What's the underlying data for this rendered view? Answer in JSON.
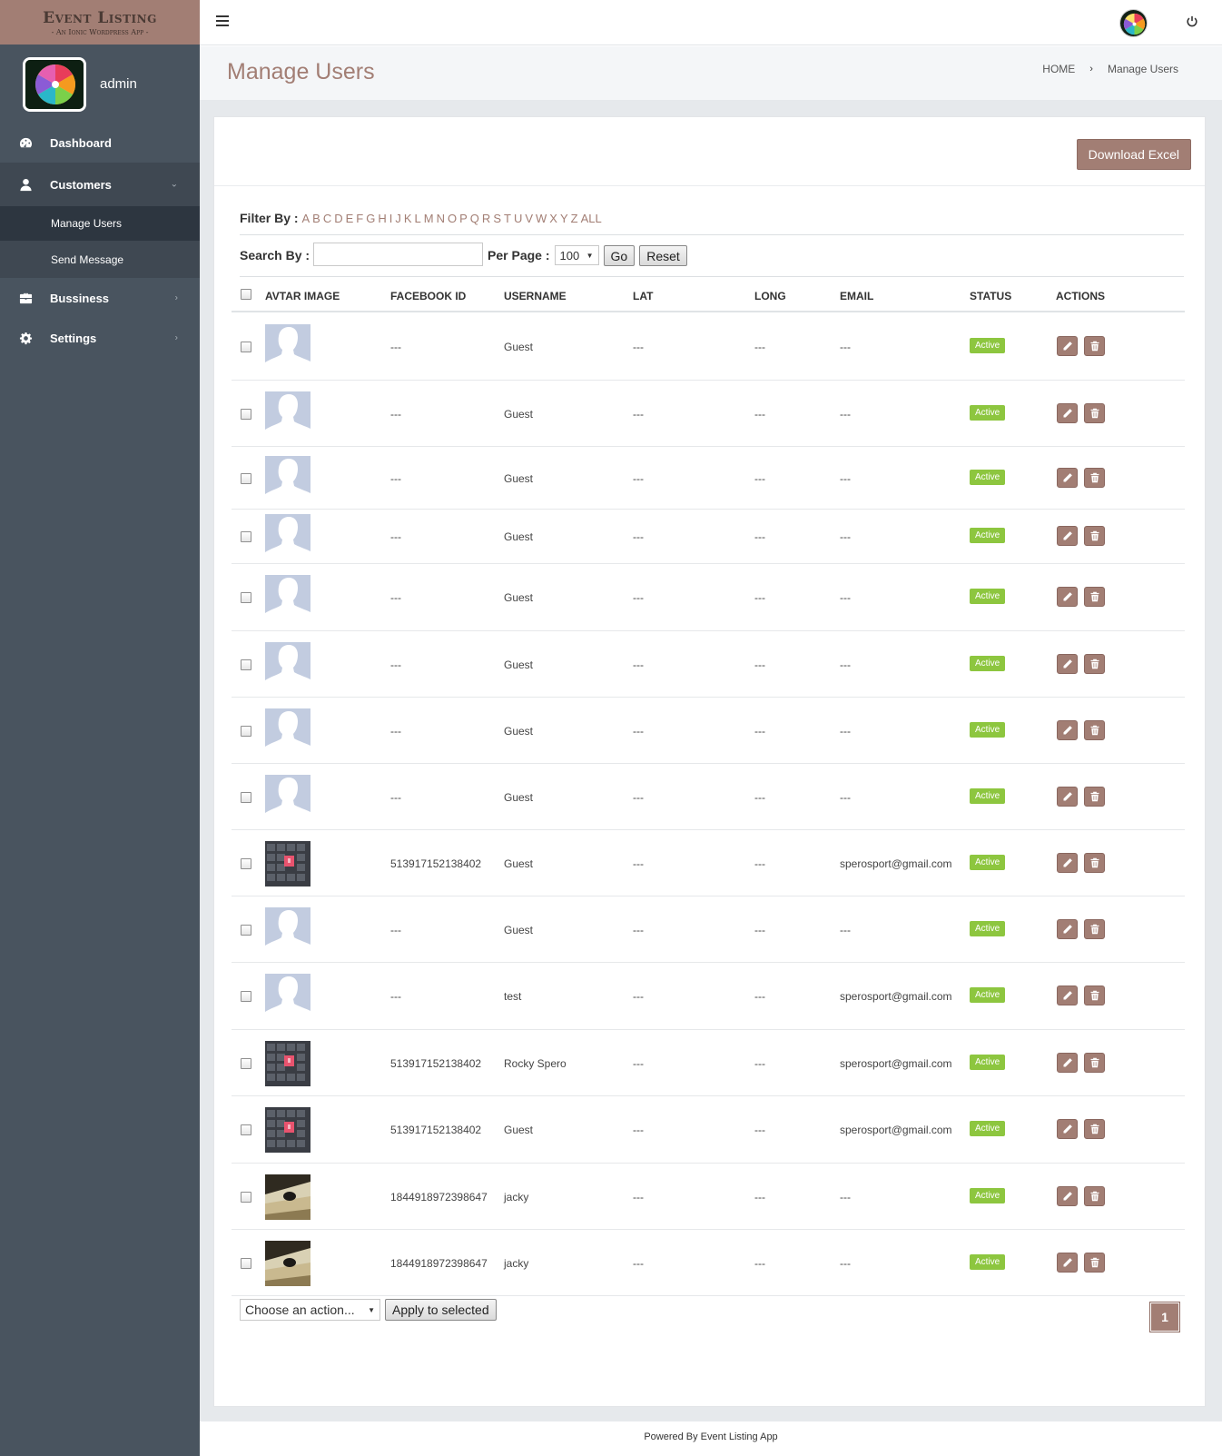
{
  "brand": {
    "title": "Event Listing",
    "subtitle": "- An Ionic Wordpress App -"
  },
  "profile": {
    "name": "admin"
  },
  "sidebar": {
    "items": [
      {
        "label": "Dashboard",
        "icon": "dashboard-icon"
      },
      {
        "label": "Customers",
        "icon": "user-icon",
        "chevron": "expanded"
      },
      {
        "label": "Bussiness",
        "icon": "briefcase-icon",
        "chevron": "collapsed"
      },
      {
        "label": "Settings",
        "icon": "gear-icon",
        "chevron": "collapsed"
      }
    ],
    "subitems": [
      {
        "label": "Manage Users"
      },
      {
        "label": "Send Message"
      }
    ]
  },
  "header": {
    "title": "Manage Users",
    "breadcrumb": {
      "home": "HOME",
      "sep": "›",
      "current": "Manage Users"
    }
  },
  "panel": {
    "download_label": "Download Excel"
  },
  "filter": {
    "label": "Filter By :",
    "letters": [
      "A",
      "B",
      "C",
      "D",
      "E",
      "F",
      "G",
      "H",
      "I",
      "J",
      "K",
      "L",
      "M",
      "N",
      "O",
      "P",
      "Q",
      "R",
      "S",
      "T",
      "U",
      "V",
      "W",
      "X",
      "Y",
      "Z",
      "ALL"
    ]
  },
  "search": {
    "label": "Search By :",
    "value": "",
    "per_page_label": "Per Page :",
    "per_page_value": "100",
    "go_label": "Go",
    "reset_label": "Reset"
  },
  "table": {
    "columns": [
      "AVTAR IMAGE",
      "FACEBOOK ID",
      "USERNAME",
      "LAT",
      "LONG",
      "EMAIL",
      "STATUS",
      "ACTIONS"
    ],
    "rows": [
      {
        "avatar": "placeholder",
        "fbid": "---",
        "username": "Guest",
        "lat": "---",
        "long": "---",
        "email": "---",
        "status": "Active"
      },
      {
        "avatar": "placeholder",
        "fbid": "---",
        "username": "Guest",
        "lat": "---",
        "long": "---",
        "email": "---",
        "status": "Active"
      },
      {
        "avatar": "placeholder",
        "fbid": "---",
        "username": "Guest",
        "lat": "---",
        "long": "---",
        "email": "---",
        "status": "Active"
      },
      {
        "avatar": "placeholder",
        "fbid": "---",
        "username": "Guest",
        "lat": "---",
        "long": "---",
        "email": "---",
        "status": "Active"
      },
      {
        "avatar": "placeholder",
        "fbid": "---",
        "username": "Guest",
        "lat": "---",
        "long": "---",
        "email": "---",
        "status": "Active"
      },
      {
        "avatar": "placeholder",
        "fbid": "---",
        "username": "Guest",
        "lat": "---",
        "long": "---",
        "email": "---",
        "status": "Active"
      },
      {
        "avatar": "placeholder",
        "fbid": "---",
        "username": "Guest",
        "lat": "---",
        "long": "---",
        "email": "---",
        "status": "Active"
      },
      {
        "avatar": "placeholder",
        "fbid": "---",
        "username": "Guest",
        "lat": "---",
        "long": "---",
        "email": "---",
        "status": "Active"
      },
      {
        "avatar": "photo-keyboard",
        "fbid": "513917152138402",
        "username": "Guest",
        "lat": "---",
        "long": "---",
        "email": "sperosport@gmail.com",
        "status": "Active"
      },
      {
        "avatar": "placeholder",
        "fbid": "---",
        "username": "Guest",
        "lat": "---",
        "long": "---",
        "email": "---",
        "status": "Active"
      },
      {
        "avatar": "placeholder",
        "fbid": "---",
        "username": "test",
        "lat": "---",
        "long": "---",
        "email": "sperosport@gmail.com",
        "status": "Active"
      },
      {
        "avatar": "photo-keyboard",
        "fbid": "513917152138402",
        "username": "Rocky Spero",
        "lat": "---",
        "long": "---",
        "email": "sperosport@gmail.com",
        "status": "Active"
      },
      {
        "avatar": "photo-keyboard",
        "fbid": "513917152138402",
        "username": "Guest",
        "lat": "---",
        "long": "---",
        "email": "sperosport@gmail.com",
        "status": "Active"
      },
      {
        "avatar": "photo-object",
        "fbid": "1844918972398647",
        "username": "jacky",
        "lat": "---",
        "long": "---",
        "email": "---",
        "status": "Active"
      },
      {
        "avatar": "photo-object",
        "fbid": "1844918972398647",
        "username": "jacky",
        "lat": "---",
        "long": "---",
        "email": "---",
        "status": "Active"
      }
    ]
  },
  "bulk": {
    "select_value": "Choose an action...",
    "apply_label": "Apply to selected"
  },
  "pagination": {
    "current": "1"
  },
  "footer": {
    "text": "Powered By Event Listing App"
  },
  "colors": {
    "accent": "#a27e74",
    "sidebar": "#49545f",
    "status_active": "#8dc63f"
  }
}
